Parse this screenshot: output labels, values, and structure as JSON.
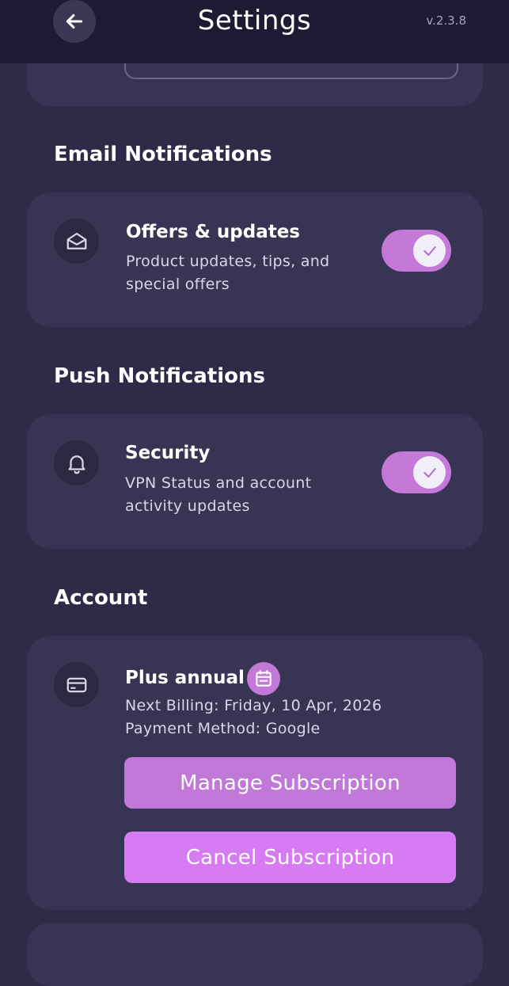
{
  "header": {
    "title": "Settings",
    "version": "v.2.3.8"
  },
  "sections": {
    "email": {
      "title": "Email Notifications",
      "item_title": "Offers & updates",
      "item_desc_line1": "Product updates, tips, and",
      "item_desc_line2": "special offers",
      "enabled": true
    },
    "push": {
      "title": "Push Notifications",
      "item_title": "Security",
      "item_desc_line1": "VPN Status and account",
      "item_desc_line2": "activity updates",
      "enabled": true
    },
    "account": {
      "title": "Account",
      "plan": "Plus annual",
      "next_billing": "Next Billing: Friday, 10 Apr, 2026",
      "payment_method": "Payment Method: Google",
      "manage_label": "Manage Subscription",
      "cancel_label": "Cancel Subscription"
    }
  },
  "icons": {
    "back": "arrow-left-icon",
    "email": "envelope-open-icon",
    "push": "bell-icon",
    "account": "credit-card-icon",
    "plan": "calendar-icon",
    "toggle": "check-icon"
  },
  "colors": {
    "background": "#2e2a47",
    "header": "#1e1a33",
    "card": "#383554",
    "accent": "#c479d9",
    "cancel": "#d67bf2"
  }
}
